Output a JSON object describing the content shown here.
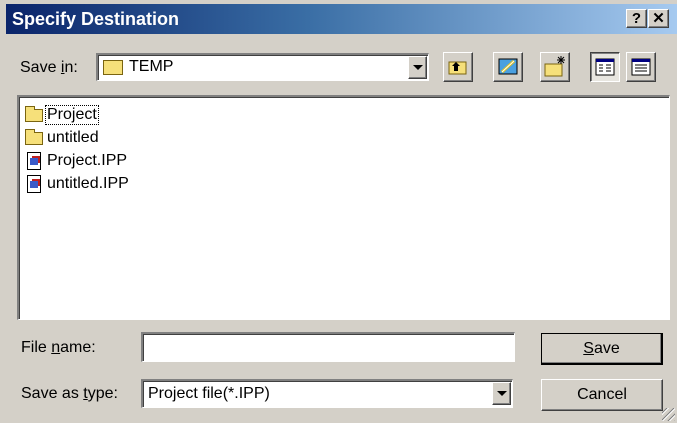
{
  "window": {
    "title": "Specify Destination",
    "help_label": "?",
    "close_label": "✕"
  },
  "save_in": {
    "label_prefix": "Save ",
    "label_accel": "i",
    "label_suffix": "n:",
    "value": "TEMP",
    "folder_icon": "folder-icon"
  },
  "toolbar": {
    "buttons": [
      {
        "name": "up-one-level",
        "icon": "folder-up-icon"
      },
      {
        "name": "desktop",
        "icon": "desktop-icon"
      },
      {
        "name": "new-folder",
        "icon": "new-folder-icon"
      },
      {
        "name": "list-view",
        "icon": "list-view-icon",
        "pressed": true
      },
      {
        "name": "details-view",
        "icon": "details-view-icon",
        "pressed": false
      }
    ]
  },
  "files": [
    {
      "name": "Project",
      "type": "folder",
      "focused": true
    },
    {
      "name": "untitled",
      "type": "folder",
      "focused": false
    },
    {
      "name": "Project.IPP",
      "type": "file",
      "focused": false
    },
    {
      "name": "untitled.IPP",
      "type": "file",
      "focused": false
    }
  ],
  "file_name": {
    "label_prefix": "File ",
    "label_accel": "n",
    "label_suffix": "ame:",
    "value": ""
  },
  "save_as_type": {
    "label_prefix": "Save as ",
    "label_accel": "t",
    "label_suffix": "ype:",
    "value": "Project file(*.IPP)"
  },
  "buttons": {
    "save_accel": "S",
    "save_rest": "ave",
    "cancel": "Cancel"
  },
  "colors": {
    "dialog_bg": "#d4d0c8",
    "titlebar_start": "#0a246a",
    "titlebar_end": "#a6caf0",
    "folder": "#f6e07a"
  }
}
